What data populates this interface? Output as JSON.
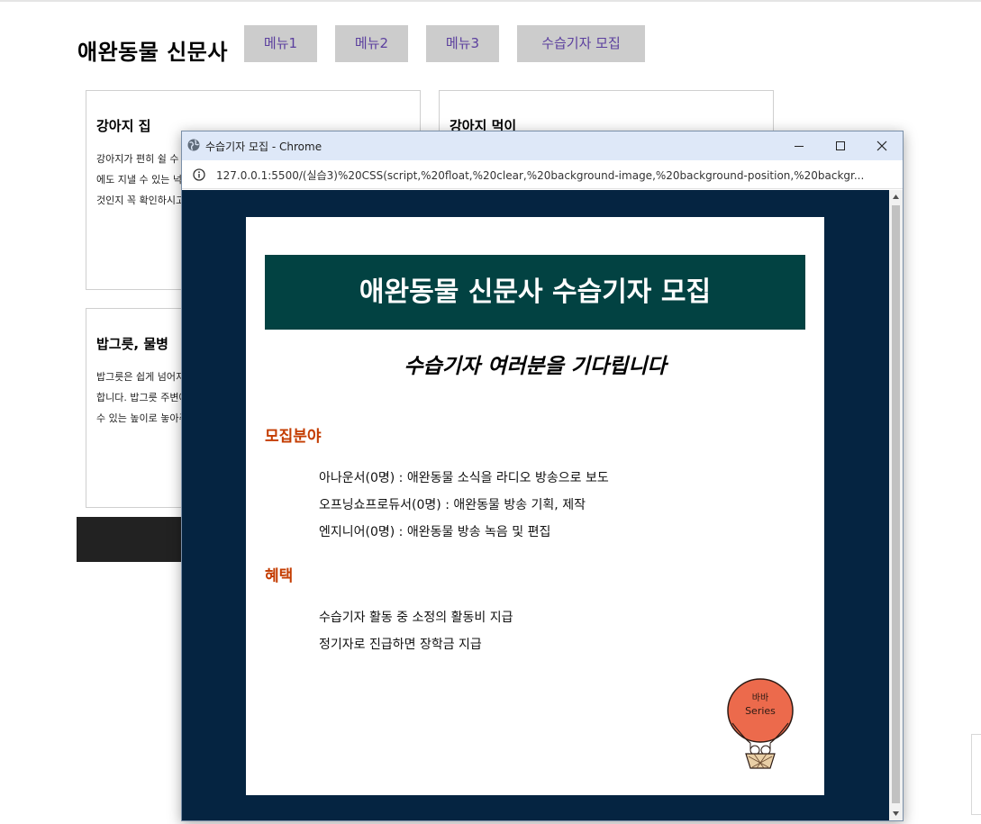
{
  "site": {
    "title": "애완동물 신문사",
    "menu": [
      "메뉴1",
      "메뉴2",
      "메뉴3",
      "수습기자 모집"
    ]
  },
  "cards": [
    {
      "title": "강아지 집",
      "text": "강아지가 편히 쉴 수 있는 집을 골라주세요. 크기가 작은 강아지가 다 큰 뒤에도 지낼 수 있는 넉넉한 집을 구입하실 때는 반드시 강아지의 크기에 맞는 것인지 꼭 확인하시고 구입하세요."
    },
    {
      "title": "강아지 먹이",
      "text": ""
    },
    {
      "title": "밥그릇, 물병",
      "text": "밥그릇은 쉽게 넘어지지 않는 것으로 고르고 물병은 대롱이 달린 것을 추천합니다. 밥그릇 주변에 털이 모두 묻지 않도록 강아지가 편하게 밥을 먹을 수 있는 높이로 놓아주세요."
    }
  ],
  "popup": {
    "window_title": "수습기자 모집 - Chrome",
    "url": "127.0.0.1:5500/(실습3)%20CSS(script,%20float,%20clear,%20background-image,%20background-position,%20backgr...",
    "banner": "애완동물 신문사 수습기자 모집",
    "subtitle": "수습기자 여러분을 기다립니다",
    "sections": [
      {
        "heading": "모집분야",
        "items": [
          "아나운서(0명) : 애완동물 소식을 라디오 방송으로 보도",
          "오프닝쇼프로듀서(0명) : 애완동물 방송 기획, 제작",
          "엔지니어(0명) : 애완동물 방송 녹음 및 편집"
        ]
      },
      {
        "heading": "혜택",
        "items": [
          "수습기자 활동 중 소정의 활동비 지급",
          "정기자로 진급하면 장학금 지급"
        ]
      }
    ],
    "logo_text": [
      "바바",
      "Series"
    ]
  },
  "colors": {
    "banner_bg": "#024242",
    "viewport_bg": "#052441",
    "section_heading": "#c43c00",
    "menu_bg": "#cccccc",
    "menu_text": "#5b3f9e"
  }
}
